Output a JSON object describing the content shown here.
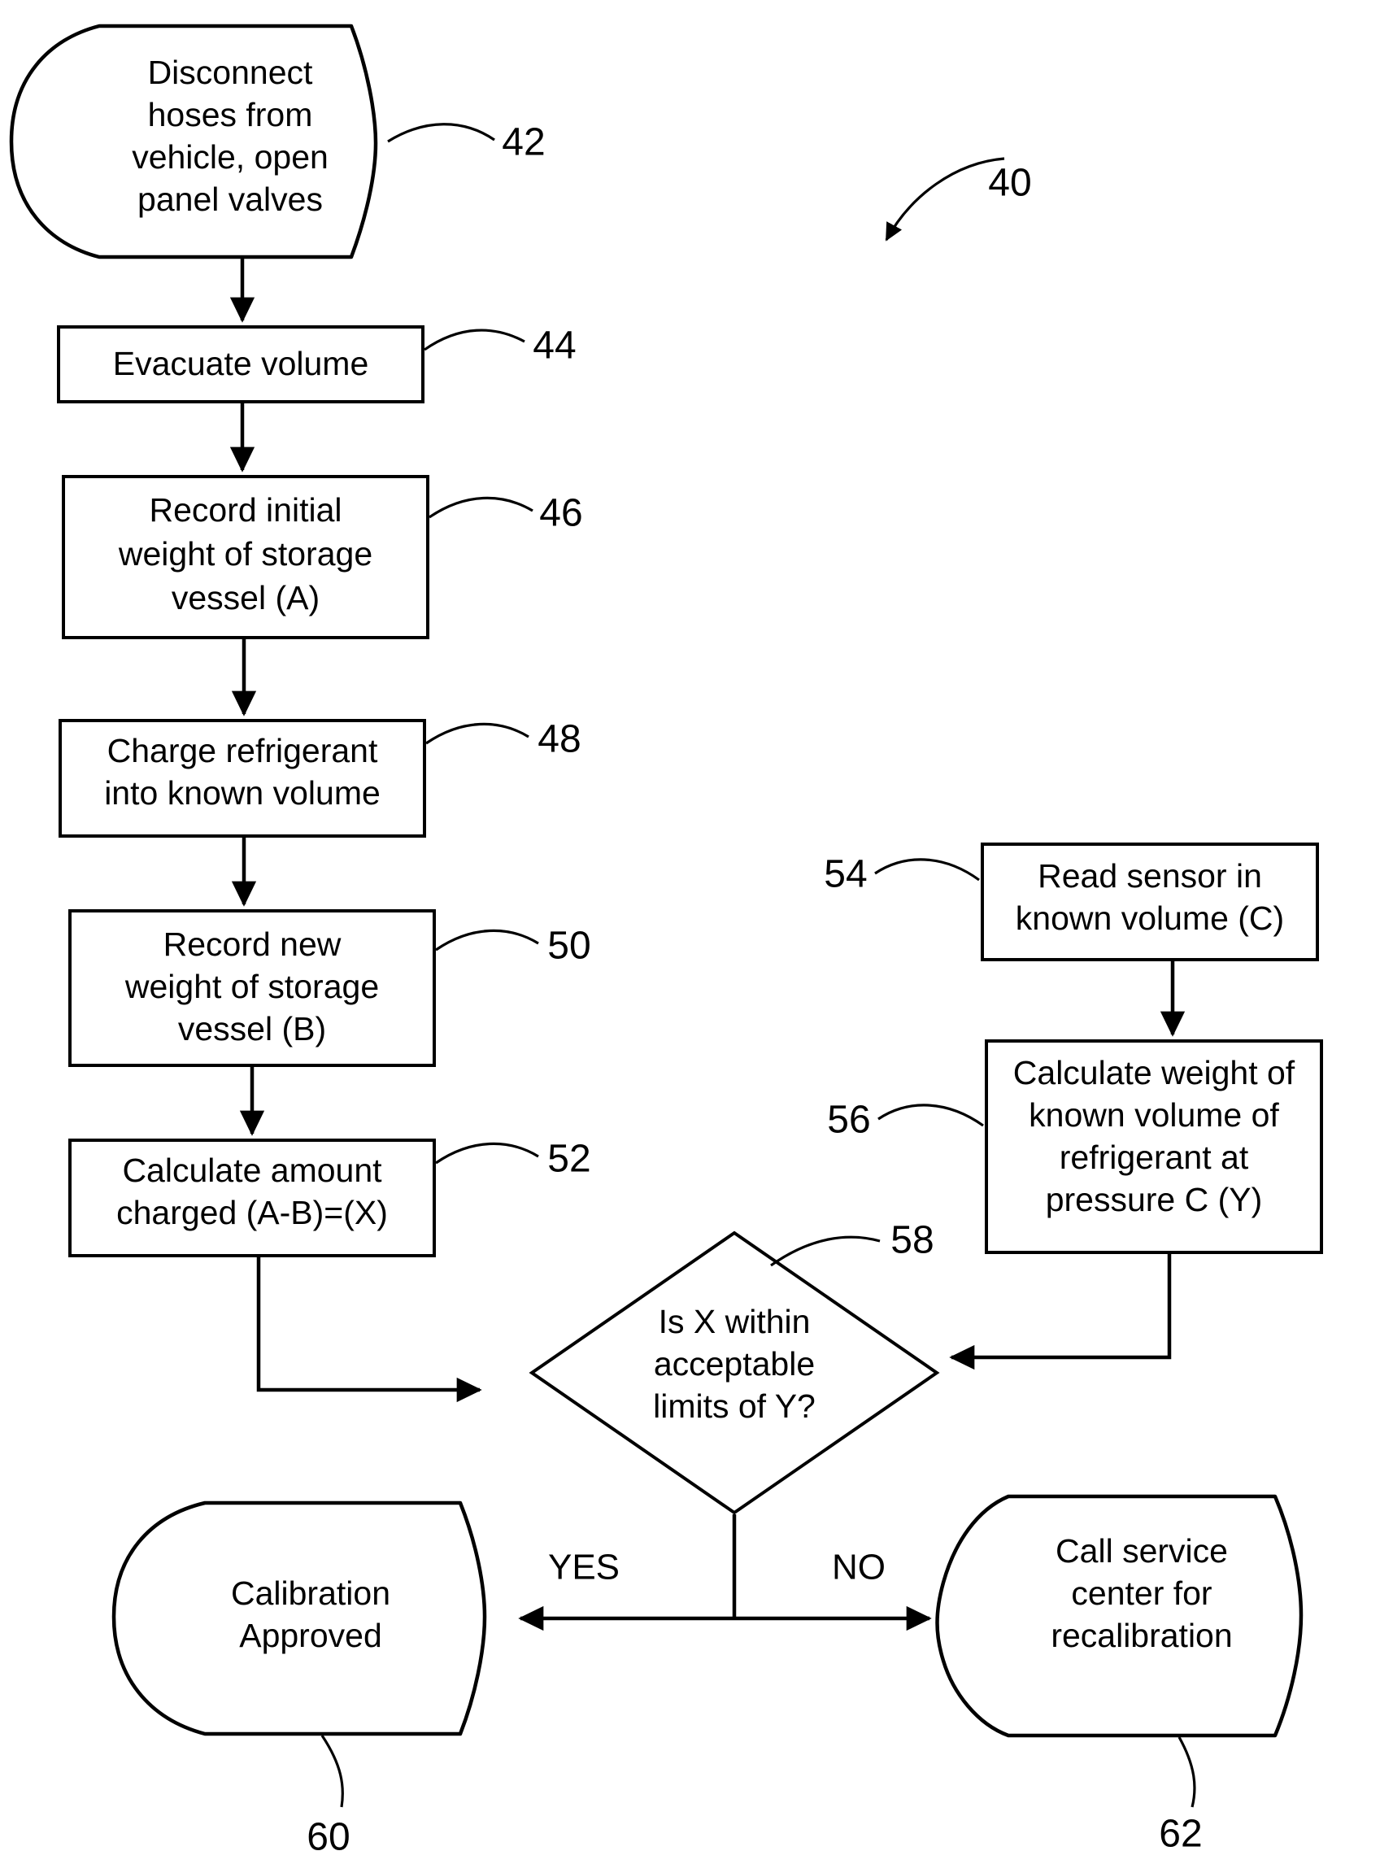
{
  "figure": {
    "reference_numeral": "40",
    "type": "process-flowchart"
  },
  "nodes": {
    "n42": {
      "ref": "42",
      "shape": "terminator",
      "lines": [
        "Disconnect",
        "hoses from",
        "vehicle, open",
        "panel valves"
      ]
    },
    "n44": {
      "ref": "44",
      "shape": "process",
      "lines": [
        "Evacuate volume"
      ]
    },
    "n46": {
      "ref": "46",
      "shape": "process",
      "lines": [
        "Record initial",
        "weight of storage",
        "vessel (A)"
      ]
    },
    "n48": {
      "ref": "48",
      "shape": "process",
      "lines": [
        "Charge refrigerant",
        "into known volume"
      ]
    },
    "n50": {
      "ref": "50",
      "shape": "process",
      "lines": [
        "Record new",
        "weight of storage",
        "vessel (B)"
      ]
    },
    "n52": {
      "ref": "52",
      "shape": "process",
      "lines": [
        "Calculate amount",
        "charged (A-B)=(X)"
      ]
    },
    "n54": {
      "ref": "54",
      "shape": "process",
      "lines": [
        "Read sensor in",
        "known volume (C)"
      ]
    },
    "n56": {
      "ref": "56",
      "shape": "process",
      "lines": [
        "Calculate weight of",
        "known volume of",
        "refrigerant at",
        "pressure C (Y)"
      ]
    },
    "n58": {
      "ref": "58",
      "shape": "decision",
      "lines": [
        "Is X within",
        "acceptable",
        "limits of Y?"
      ]
    },
    "n60": {
      "ref": "60",
      "shape": "terminator",
      "lines": [
        "Calibration",
        "Approved"
      ]
    },
    "n62": {
      "ref": "62",
      "shape": "terminator",
      "lines": [
        "Call service",
        "center for",
        "recalibration"
      ]
    }
  },
  "branch_labels": {
    "yes": "YES",
    "no": "NO"
  },
  "colors": {
    "ink": "#000000",
    "paper": "#ffffff"
  }
}
